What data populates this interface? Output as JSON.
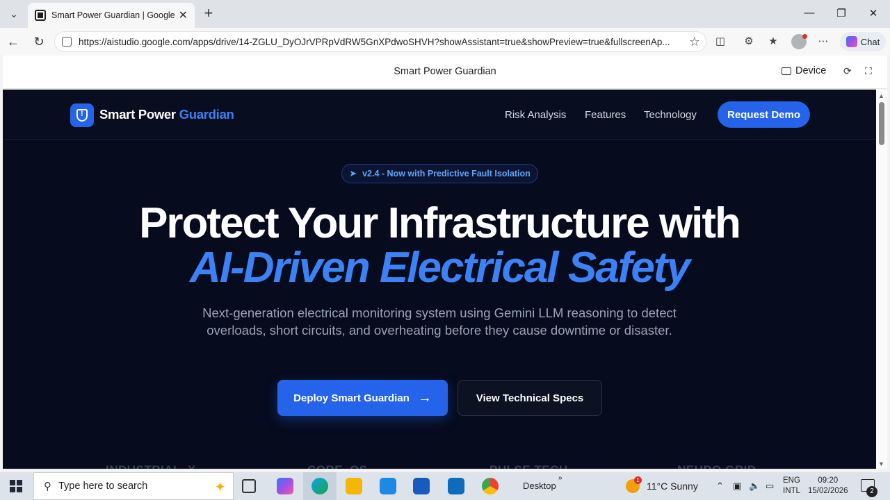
{
  "browser": {
    "tab_title": "Smart Power Guardian | Google AI",
    "url": "https://aistudio.google.com/apps/drive/14-ZGLU_DyOJrVPRpVdRW5GnXPdwoSHVH?showAssistant=true&showPreview=true&fullscreenAp...",
    "chat_label": "Chat"
  },
  "studio": {
    "title": "Smart Power Guardian",
    "device_label": "Device"
  },
  "app": {
    "brand_prefix": "Smart Power ",
    "brand_accent": "Guardian",
    "nav": [
      "Risk Analysis",
      "Features",
      "Technology"
    ],
    "demo_button": "Request Demo",
    "version_pill": "v2.4 - Now with Predictive Fault Isolation",
    "headline_line1": "Protect Your Infrastructure with",
    "headline_line2": "AI-Driven Electrical Safety",
    "subtext": "Next-generation electrical monitoring system using Gemini LLM reasoning to detect overloads, short circuits, and overheating before they cause downtime or disaster.",
    "cta_primary": "Deploy Smart Guardian",
    "cta_secondary": "View Technical Specs",
    "partners": [
      "INDUSTRIAL_X",
      "CORE_OS",
      "PULSE TECH",
      "NEURO GRID"
    ],
    "colors": {
      "accent": "#2563eb",
      "accent_text": "#3b82f6",
      "background": "#060b1d"
    }
  },
  "taskbar": {
    "search_placeholder": "Type here to search",
    "desktop_label": "Desktop",
    "weather_badge": "1",
    "weather": "11°C  Sunny",
    "lang_line1": "ENG",
    "lang_line2": "INTL",
    "time": "09:20",
    "date": "15/02/2026",
    "notifications": "2"
  }
}
